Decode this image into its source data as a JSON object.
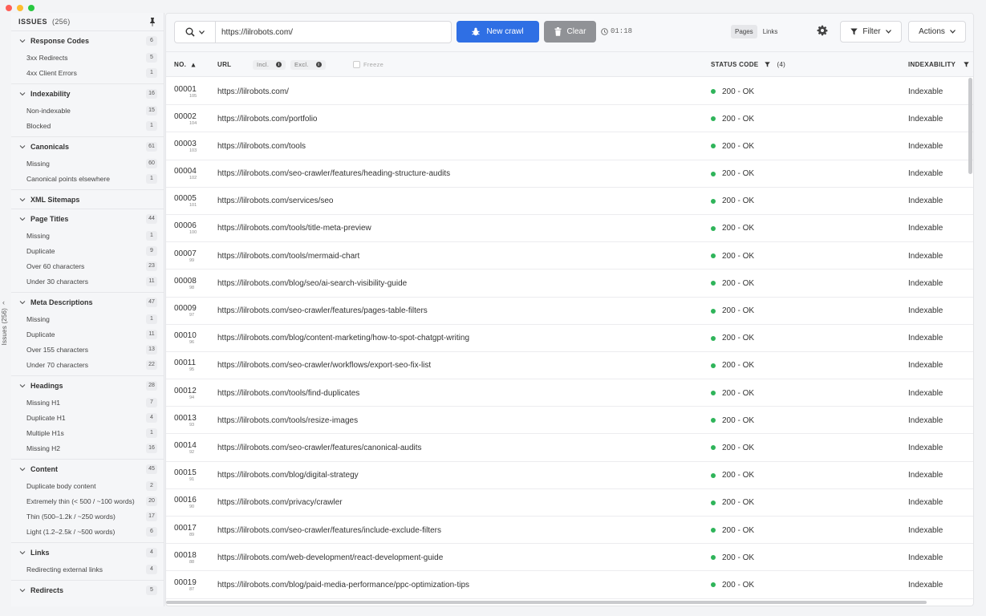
{
  "sidebar": {
    "title": "ISSUES",
    "total": "(256)",
    "groups": [
      {
        "label": "Response Codes",
        "count": "6",
        "items": [
          {
            "label": "3xx Redirects",
            "count": "5"
          },
          {
            "label": "4xx Client Errors",
            "count": "1"
          }
        ]
      },
      {
        "label": "Indexability",
        "count": "16",
        "items": [
          {
            "label": "Non-indexable",
            "count": "15"
          },
          {
            "label": "Blocked",
            "count": "1"
          }
        ]
      },
      {
        "label": "Canonicals",
        "count": "61",
        "items": [
          {
            "label": "Missing",
            "count": "60"
          },
          {
            "label": "Canonical points elsewhere",
            "count": "1"
          }
        ]
      },
      {
        "label": "XML Sitemaps",
        "count": "",
        "items": []
      },
      {
        "label": "Page Titles",
        "count": "44",
        "items": [
          {
            "label": "Missing",
            "count": "1"
          },
          {
            "label": "Duplicate",
            "count": "9"
          },
          {
            "label": "Over 60 characters",
            "count": "23"
          },
          {
            "label": "Under 30 characters",
            "count": "11"
          }
        ]
      },
      {
        "label": "Meta Descriptions",
        "count": "47",
        "items": [
          {
            "label": "Missing",
            "count": "1"
          },
          {
            "label": "Duplicate",
            "count": "11"
          },
          {
            "label": "Over 155 characters",
            "count": "13"
          },
          {
            "label": "Under 70 characters",
            "count": "22"
          }
        ]
      },
      {
        "label": "Headings",
        "count": "28",
        "items": [
          {
            "label": "Missing H1",
            "count": "7"
          },
          {
            "label": "Duplicate H1",
            "count": "4"
          },
          {
            "label": "Multiple H1s",
            "count": "1"
          },
          {
            "label": "Missing H2",
            "count": "16"
          }
        ]
      },
      {
        "label": "Content",
        "count": "45",
        "items": [
          {
            "label": "Duplicate body content",
            "count": "2"
          },
          {
            "label": "Extremely thin (< 500 / ~100 words)",
            "count": "20"
          },
          {
            "label": "Thin (500–1.2k / ~250 words)",
            "count": "17"
          },
          {
            "label": "Light (1.2–2.5k / ~500 words)",
            "count": "6"
          }
        ]
      },
      {
        "label": "Links",
        "count": "4",
        "items": [
          {
            "label": "Redirecting external links",
            "count": "4"
          }
        ]
      },
      {
        "label": "Redirects",
        "count": "5",
        "items": []
      }
    ]
  },
  "rail": {
    "label": "Issues (256)"
  },
  "toolbar": {
    "url_value": "https://lilrobots.com/",
    "new_crawl_label": "New crawl",
    "clear_label": "Clear",
    "timer": "01:18",
    "tab_pages": "Pages",
    "tab_links": "Links",
    "filter_label": "Filter",
    "actions_label": "Actions"
  },
  "table": {
    "col_no": "NO.",
    "col_url": "URL",
    "incl": "Incl.",
    "excl": "Excl.",
    "freeze": "Freeze",
    "col_status": "STATUS CODE",
    "status_filter_count": "(4)",
    "col_indexability": "INDEXABILITY",
    "rows": [
      {
        "no": "00001",
        "sub": "105",
        "url": "https://lilrobots.com/",
        "status": "200 - OK",
        "idx": "Indexable"
      },
      {
        "no": "00002",
        "sub": "104",
        "url": "https://lilrobots.com/portfolio",
        "status": "200 - OK",
        "idx": "Indexable"
      },
      {
        "no": "00003",
        "sub": "103",
        "url": "https://lilrobots.com/tools",
        "status": "200 - OK",
        "idx": "Indexable"
      },
      {
        "no": "00004",
        "sub": "102",
        "url": "https://lilrobots.com/seo-crawler/features/heading-structure-audits",
        "status": "200 - OK",
        "idx": "Indexable"
      },
      {
        "no": "00005",
        "sub": "101",
        "url": "https://lilrobots.com/services/seo",
        "status": "200 - OK",
        "idx": "Indexable"
      },
      {
        "no": "00006",
        "sub": "100",
        "url": "https://lilrobots.com/tools/title-meta-preview",
        "status": "200 - OK",
        "idx": "Indexable"
      },
      {
        "no": "00007",
        "sub": "99",
        "url": "https://lilrobots.com/tools/mermaid-chart",
        "status": "200 - OK",
        "idx": "Indexable"
      },
      {
        "no": "00008",
        "sub": "98",
        "url": "https://lilrobots.com/blog/seo/ai-search-visibility-guide",
        "status": "200 - OK",
        "idx": "Indexable"
      },
      {
        "no": "00009",
        "sub": "97",
        "url": "https://lilrobots.com/seo-crawler/features/pages-table-filters",
        "status": "200 - OK",
        "idx": "Indexable"
      },
      {
        "no": "00010",
        "sub": "96",
        "url": "https://lilrobots.com/blog/content-marketing/how-to-spot-chatgpt-writing",
        "status": "200 - OK",
        "idx": "Indexable"
      },
      {
        "no": "00011",
        "sub": "95",
        "url": "https://lilrobots.com/seo-crawler/workflows/export-seo-fix-list",
        "status": "200 - OK",
        "idx": "Indexable"
      },
      {
        "no": "00012",
        "sub": "94",
        "url": "https://lilrobots.com/tools/find-duplicates",
        "status": "200 - OK",
        "idx": "Indexable"
      },
      {
        "no": "00013",
        "sub": "93",
        "url": "https://lilrobots.com/tools/resize-images",
        "status": "200 - OK",
        "idx": "Indexable"
      },
      {
        "no": "00014",
        "sub": "92",
        "url": "https://lilrobots.com/seo-crawler/features/canonical-audits",
        "status": "200 - OK",
        "idx": "Indexable"
      },
      {
        "no": "00015",
        "sub": "91",
        "url": "https://lilrobots.com/blog/digital-strategy",
        "status": "200 - OK",
        "idx": "Indexable"
      },
      {
        "no": "00016",
        "sub": "90",
        "url": "https://lilrobots.com/privacy/crawler",
        "status": "200 - OK",
        "idx": "Indexable"
      },
      {
        "no": "00017",
        "sub": "89",
        "url": "https://lilrobots.com/seo-crawler/features/include-exclude-filters",
        "status": "200 - OK",
        "idx": "Indexable"
      },
      {
        "no": "00018",
        "sub": "88",
        "url": "https://lilrobots.com/web-development/react-development-guide",
        "status": "200 - OK",
        "idx": "Indexable"
      },
      {
        "no": "00019",
        "sub": "87",
        "url": "https://lilrobots.com/blog/paid-media-performance/ppc-optimization-tips",
        "status": "200 - OK",
        "idx": "Indexable"
      }
    ]
  },
  "colors": {
    "accent": "#2f6fe4",
    "ok": "#2fb45a",
    "clear_button": "#909296"
  }
}
